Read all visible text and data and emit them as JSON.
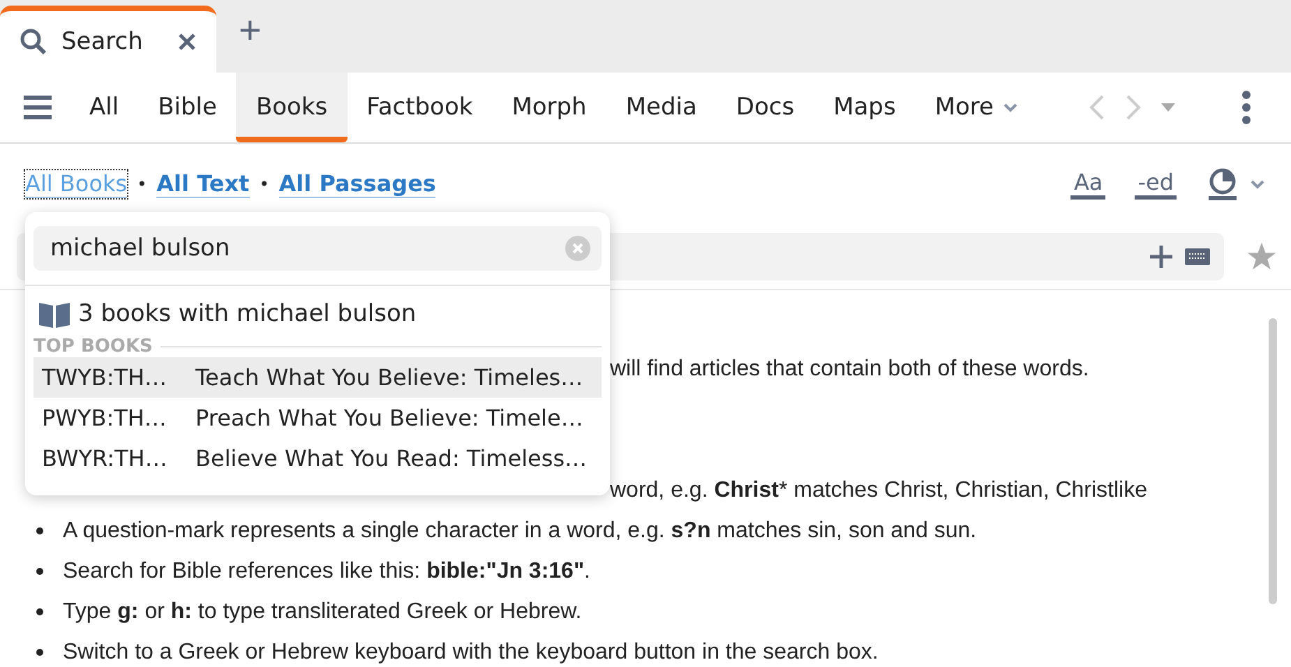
{
  "tabs": [
    {
      "label": "Search",
      "selected": true
    }
  ],
  "new_tab": "+",
  "categories": [
    {
      "label": "All",
      "selected": false
    },
    {
      "label": "Bible",
      "selected": false
    },
    {
      "label": "Books",
      "selected": true
    },
    {
      "label": "Factbook",
      "selected": false
    },
    {
      "label": "Morph",
      "selected": false
    },
    {
      "label": "Media",
      "selected": false
    },
    {
      "label": "Docs",
      "selected": false
    },
    {
      "label": "Maps",
      "selected": false
    }
  ],
  "more": "More",
  "scopes": [
    {
      "label": "All Books",
      "focused": true
    },
    {
      "label": "All Text",
      "focused": false
    },
    {
      "label": "All Passages",
      "focused": false
    }
  ],
  "scope_separator": "•",
  "format_buttons": [
    "Aa",
    "-ed"
  ],
  "popup": {
    "query": "michael bulson",
    "summary": "3 books with michael bulson",
    "section": "TOP BOOKS",
    "results": [
      {
        "abbrev": "TWYB:TH…",
        "title": "Teach What You Believe: Timeles…",
        "selected": true
      },
      {
        "abbrev": "PWYB:TH…",
        "title": "Preach What You Believe: Timele…",
        "selected": false
      },
      {
        "abbrev": "BWYR:TH…",
        "title": "Believe What You Read: Timeless…",
        "selected": false
      }
    ]
  },
  "help_lines": [
    {
      "kind": "partial",
      "text": "will find articles that contain both of these words."
    },
    {
      "kind": "gap"
    },
    {
      "kind": "gap"
    },
    {
      "kind": "partial",
      "text": "word, e.g. **Christ*** matches Christ, Christian, Christlike"
    },
    {
      "kind": "bullet",
      "text": "A question-mark represents a single character in a word, e.g. **s?n** matches sin, son and sun."
    },
    {
      "kind": "bullet",
      "text": "Search for Bible references like this: **bible:\"Jn 3:16\"**."
    },
    {
      "kind": "bullet",
      "text": "Type **g:** or **h:** to type transliterated Greek or Hebrew."
    },
    {
      "kind": "bullet",
      "text": "Switch to a Greek or Hebrew keyboard with the keyboard button in the search box."
    }
  ]
}
